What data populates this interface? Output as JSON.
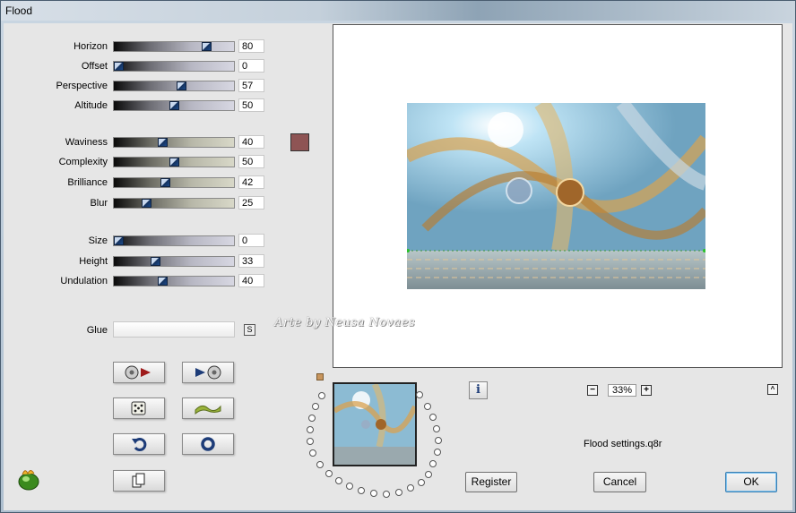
{
  "window": {
    "title": "Flood"
  },
  "sliders": [
    {
      "label": "Horizon",
      "value": "80",
      "level": 80
    },
    {
      "label": "Offset",
      "value": "0",
      "level": 0
    },
    {
      "label": "Perspective",
      "value": "57",
      "level": 57
    },
    {
      "label": "Altitude",
      "value": "50",
      "level": 50
    },
    {
      "label": "Waviness",
      "value": "40",
      "level": 40
    },
    {
      "label": "Complexity",
      "value": "50",
      "level": 50
    },
    {
      "label": "Brilliance",
      "value": "42",
      "level": 42
    },
    {
      "label": "Blur",
      "value": "25",
      "level": 25
    },
    {
      "label": "Size",
      "value": "0",
      "level": 0
    },
    {
      "label": "Height",
      "value": "33",
      "level": 33
    },
    {
      "label": "Undulation",
      "value": "40",
      "level": 40
    }
  ],
  "color_swatch": "#8e5454",
  "glue": {
    "label": "Glue",
    "value": "",
    "button": "S"
  },
  "icon_buttons": [
    {
      "icon": "load-preset-icon"
    },
    {
      "icon": "save-preset-icon"
    },
    {
      "icon": "random-dice-icon"
    },
    {
      "icon": "wave-icon"
    },
    {
      "icon": "undo-icon"
    },
    {
      "icon": "reset-icon"
    },
    {
      "icon": "copy-icon"
    }
  ],
  "watermark": "Arte by  Neusa Novaes",
  "info_button": "i",
  "zoom": {
    "value": "33%",
    "minus": "−",
    "plus": "+"
  },
  "collapse_button": "^",
  "settings_file": "Flood settings.q8r",
  "buttons": {
    "register": "Register",
    "cancel": "Cancel",
    "ok": "OK"
  }
}
